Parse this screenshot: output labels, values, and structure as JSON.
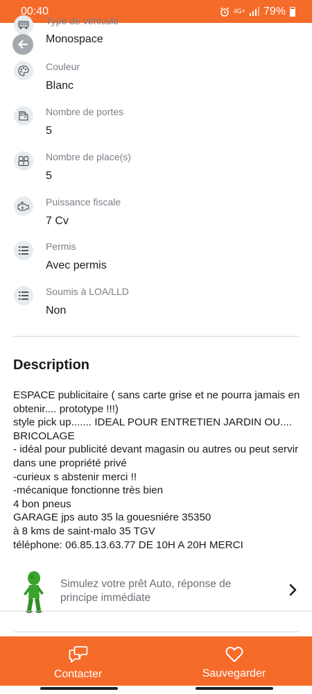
{
  "status_bar": {
    "time": "00:40",
    "network": "4G+",
    "battery": "79%"
  },
  "attributes": [
    {
      "label": "Type de véhicule",
      "value": "Monospace",
      "icon": "van-icon"
    },
    {
      "label": "Couleur",
      "value": "Blanc",
      "icon": "palette-icon"
    },
    {
      "label": "Nombre de portes",
      "value": "5",
      "icon": "car-door-icon"
    },
    {
      "label": "Nombre de place(s)",
      "value": "5",
      "icon": "car-seats-icon"
    },
    {
      "label": "Puissance fiscale",
      "value": "7 Cv",
      "icon": "engine-icon"
    },
    {
      "label": "Permis",
      "value": "Avec permis",
      "icon": "list-icon"
    },
    {
      "label": "Soumis à LOA/LLD",
      "value": "Non",
      "icon": "list-icon"
    }
  ],
  "description": {
    "title": "Description",
    "text": "ESPACE publicitaire ( sans carte grise et ne pourra jamais en obtenir.... prototype !!!)\nstyle pick up.......  IDEAL POUR ENTRETIEN JARDIN OU.... BRICOLAGE\n- idéal pour publicité devant magasin ou autres ou peut servir dans une  propriété privé\n-curieux s abstenir merci !!\n-mécanique fonctionne très bien\n4 bon pneus\nGARAGE jps auto 35 la gouesniére 35350\nà 8 kms de saint-malo 35  TGV\ntéléphone: 06.85.13.63.77 DE 10H A 20H MERCI"
  },
  "loan": {
    "text": "Simulez votre prêt Auto, réponse de principe immédiate"
  },
  "bottom_bar": {
    "contact_label": "Contacter",
    "save_label": "Sauvegarder"
  },
  "colors": {
    "brand": "#f56b2a",
    "icon_bg": "#e6ebf0",
    "label": "#7a7f86"
  }
}
